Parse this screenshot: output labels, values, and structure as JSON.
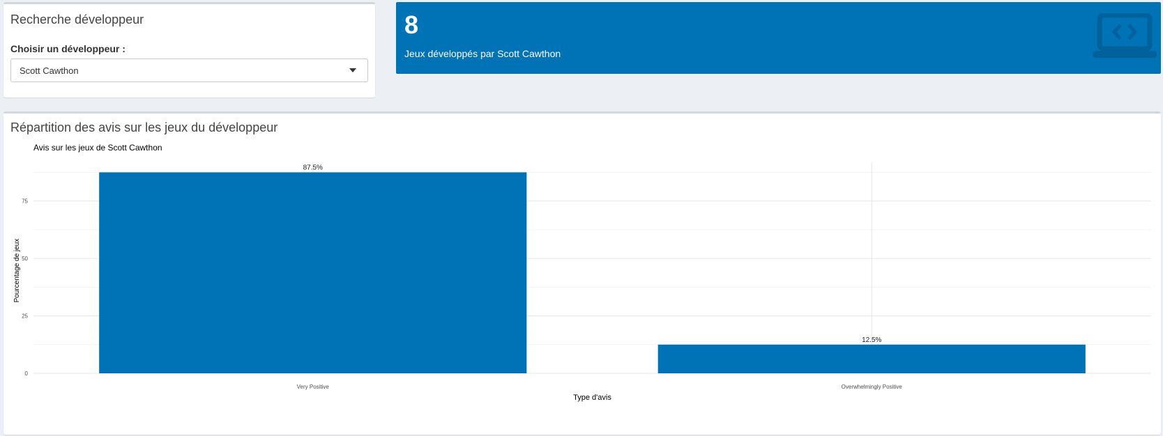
{
  "search_box": {
    "title": "Recherche développeur",
    "select_label": "Choisir un développeur :",
    "selected_developer": "Scott Cawthon"
  },
  "value_box": {
    "value": "8",
    "subtitle": "Jeux développés par Scott Cawthon",
    "icon": "laptop-code-icon",
    "color": "#0073b7"
  },
  "chart_box": {
    "title": "Répartition des avis sur les jeux du développeur"
  },
  "chart_data": {
    "type": "bar",
    "title": "Avis sur les jeux de Scott Cawthon",
    "xlabel": "Type d'avis",
    "ylabel": "Pourcentage de jeux",
    "categories": [
      "Very Positive",
      "Overwhelmingly Positive"
    ],
    "values": [
      87.5,
      12.5
    ],
    "data_labels": [
      "87.5%",
      "12.5%"
    ],
    "y_ticks": [
      0,
      25,
      50,
      75
    ],
    "y_tick_labels": [
      "0",
      "25",
      "50",
      "75"
    ],
    "ylim": [
      0,
      91.875
    ],
    "bar_color": "#0073b7",
    "grid": true,
    "legend": "none"
  }
}
